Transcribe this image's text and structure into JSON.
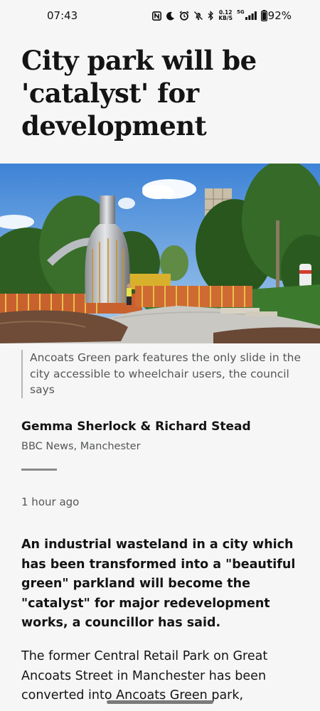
{
  "status_bar": {
    "time": "07:43",
    "net_speed_value": "0.12",
    "net_speed_unit": "KB/S",
    "network_type": "5G",
    "battery_percent": "92%",
    "icons": [
      "nfc-icon",
      "moon-icon",
      "alarm-icon",
      "mute-icon",
      "bluetooth-icon",
      "signal-icon",
      "battery-icon"
    ]
  },
  "article": {
    "headline": "City park will be 'catalyst' for development",
    "image_caption": "Ancoats Green park features the only slide in the city accessible to wheelchair users, the council says",
    "author": "Gemma Sherlock & Richard Stead",
    "organisation": "BBC News, Manchester",
    "published": "1 hour ago",
    "lead": "An industrial wasteland in a city which has been transformed into a \"beautiful green\" parkland will become the \"catalyst\" for major redevelopment works, a councillor has said.",
    "para_before_link": "The former Central Retail Park on Great Ancoats Street in Manchester has been converted into ",
    "para_link": "Ancoats Green",
    "para_after_link": " park,"
  },
  "colors": {
    "background": "#f6f6f6",
    "text": "#141414",
    "muted_text": "#545658"
  }
}
